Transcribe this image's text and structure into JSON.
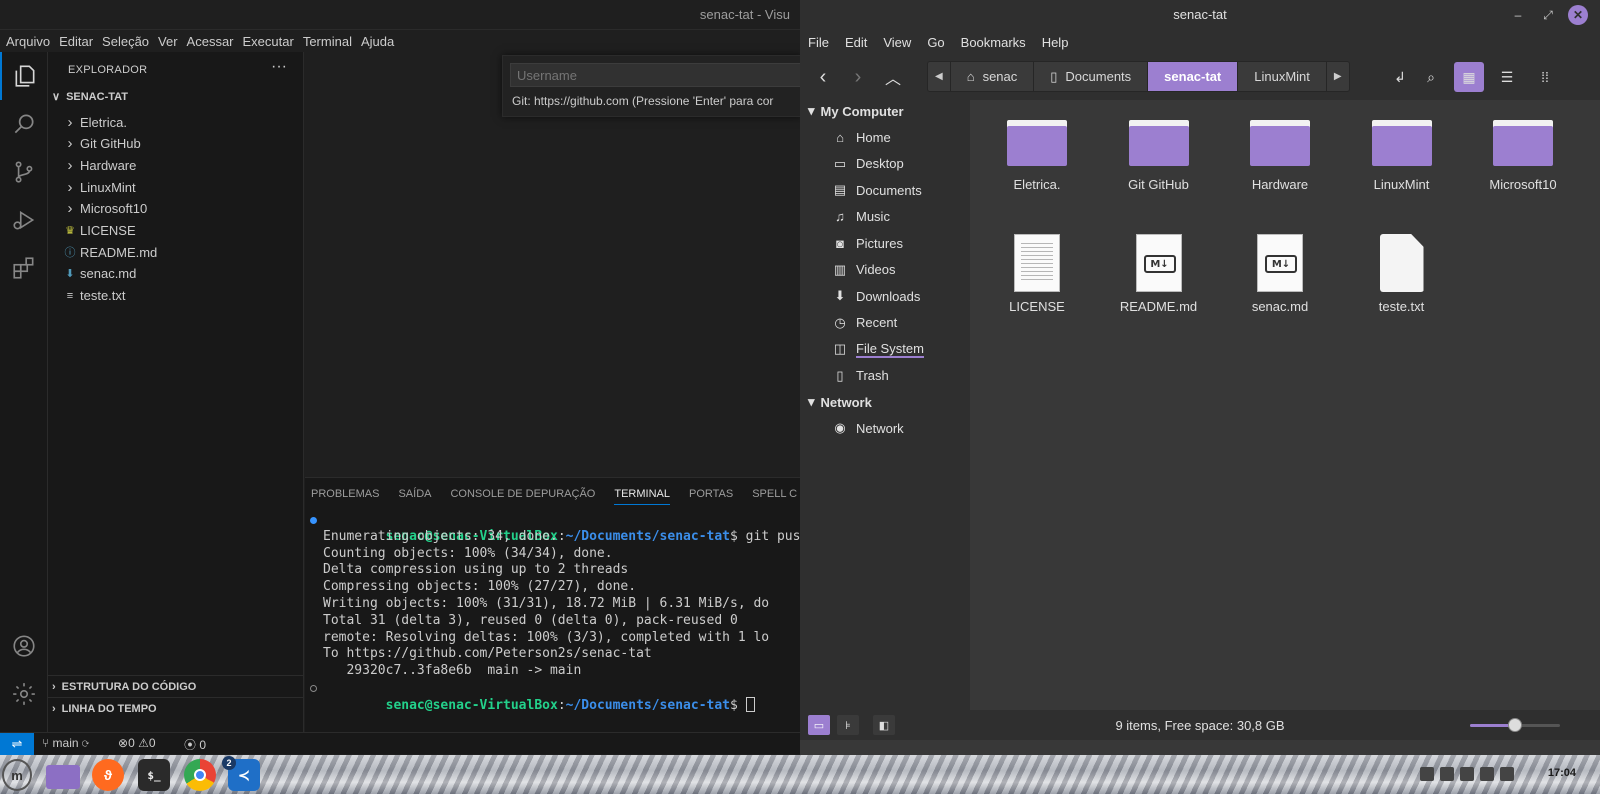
{
  "colors": {
    "vscode_accent": "#0078d4",
    "nemo_accent": "#9c7fd0",
    "prompt_green": "#23d18b",
    "prompt_blue": "#3b8eea"
  },
  "vscode": {
    "title": "senac-tat - Visu",
    "menu": [
      "Arquivo",
      "Editar",
      "Seleção",
      "Ver",
      "Acessar",
      "Executar",
      "Terminal",
      "Ajuda"
    ],
    "activity_icons": [
      "explorer-icon",
      "search-icon",
      "source-control-icon",
      "run-debug-icon",
      "extensions-icon",
      "account-icon",
      "manage-gear-icon"
    ],
    "explorer": {
      "header": "EXPLORADOR",
      "more": "···",
      "folder": "SENAC-TAT",
      "items": [
        {
          "label": "Eletrica.",
          "kind": "folder"
        },
        {
          "label": "Git GitHub",
          "kind": "folder"
        },
        {
          "label": "Hardware",
          "kind": "folder"
        },
        {
          "label": "LinuxMint",
          "kind": "folder"
        },
        {
          "label": "Microsoft10",
          "kind": "folder"
        },
        {
          "label": "LICENSE",
          "kind": "license"
        },
        {
          "label": "README.md",
          "kind": "info"
        },
        {
          "label": "senac.md",
          "kind": "markdown"
        },
        {
          "label": "teste.txt",
          "kind": "text"
        }
      ],
      "outline": "ESTRUTURA DO CÓDIGO",
      "timeline": "LINHA DO TEMPO"
    },
    "quick_input": {
      "placeholder": "Username",
      "message": "Git: https://github.com (Pressione 'Enter' para cor"
    },
    "panel_tabs": [
      "PROBLEMAS",
      "SAÍDA",
      "CONSOLE DE DEPURAÇÃO",
      "TERMINAL",
      "PORTAS",
      "SPELL C"
    ],
    "active_panel_tab": "TERMINAL",
    "terminal": {
      "prompt_user": "senac@senac-VirtualBox",
      "prompt_path": "~/Documents/senac-tat",
      "command": "git push",
      "output": [
        "Enumerating objects: 34, done.",
        "Counting objects: 100% (34/34), done.",
        "Delta compression using up to 2 threads",
        "Compressing objects: 100% (27/27), done.",
        "Writing objects: 100% (31/31), 18.72 MiB | 6.31 MiB/s, do",
        "Total 31 (delta 3), reused 0 (delta 0), pack-reused 0",
        "remote: Resolving deltas: 100% (3/3), completed with 1 lo",
        "To https://github.com/Peterson2s/senac-tat",
        "   29320c7..3fa8e6b  main -> main"
      ]
    },
    "status": {
      "branch": "main",
      "errors": "0",
      "warnings": "0",
      "ports": "0"
    }
  },
  "nemo": {
    "title": "senac-tat",
    "menu": [
      "File",
      "Edit",
      "View",
      "Go",
      "Bookmarks",
      "Help"
    ],
    "breadcrumbs": [
      "senac",
      "Documents",
      "senac-tat",
      "LinuxMint"
    ],
    "active_crumb": "senac-tat",
    "sections": {
      "my_computer": "My Computer",
      "network": "Network"
    },
    "places": [
      "Home",
      "Desktop",
      "Documents",
      "Music",
      "Pictures",
      "Videos",
      "Downloads",
      "Recent",
      "File System",
      "Trash"
    ],
    "network_places": [
      "Network"
    ],
    "files": [
      {
        "name": "Eletrica.",
        "type": "folder"
      },
      {
        "name": "Git GitHub",
        "type": "folder"
      },
      {
        "name": "Hardware",
        "type": "folder"
      },
      {
        "name": "LinuxMint",
        "type": "folder"
      },
      {
        "name": "Microsoft10",
        "type": "folder"
      },
      {
        "name": "LICENSE",
        "type": "document"
      },
      {
        "name": "README.md",
        "type": "markdown"
      },
      {
        "name": "senac.md",
        "type": "markdown"
      },
      {
        "name": "teste.txt",
        "type": "text"
      }
    ],
    "status": "9 items, Free space: 30,8 GB",
    "zoom_fraction": 0.5
  },
  "taskbar": {
    "clock": "17:04",
    "apps": [
      "mint-menu-icon",
      "files-icon",
      "firefox-icon",
      "terminal-icon",
      "chrome-icon",
      "vscode-icon"
    ],
    "vscode_badge": "2"
  }
}
